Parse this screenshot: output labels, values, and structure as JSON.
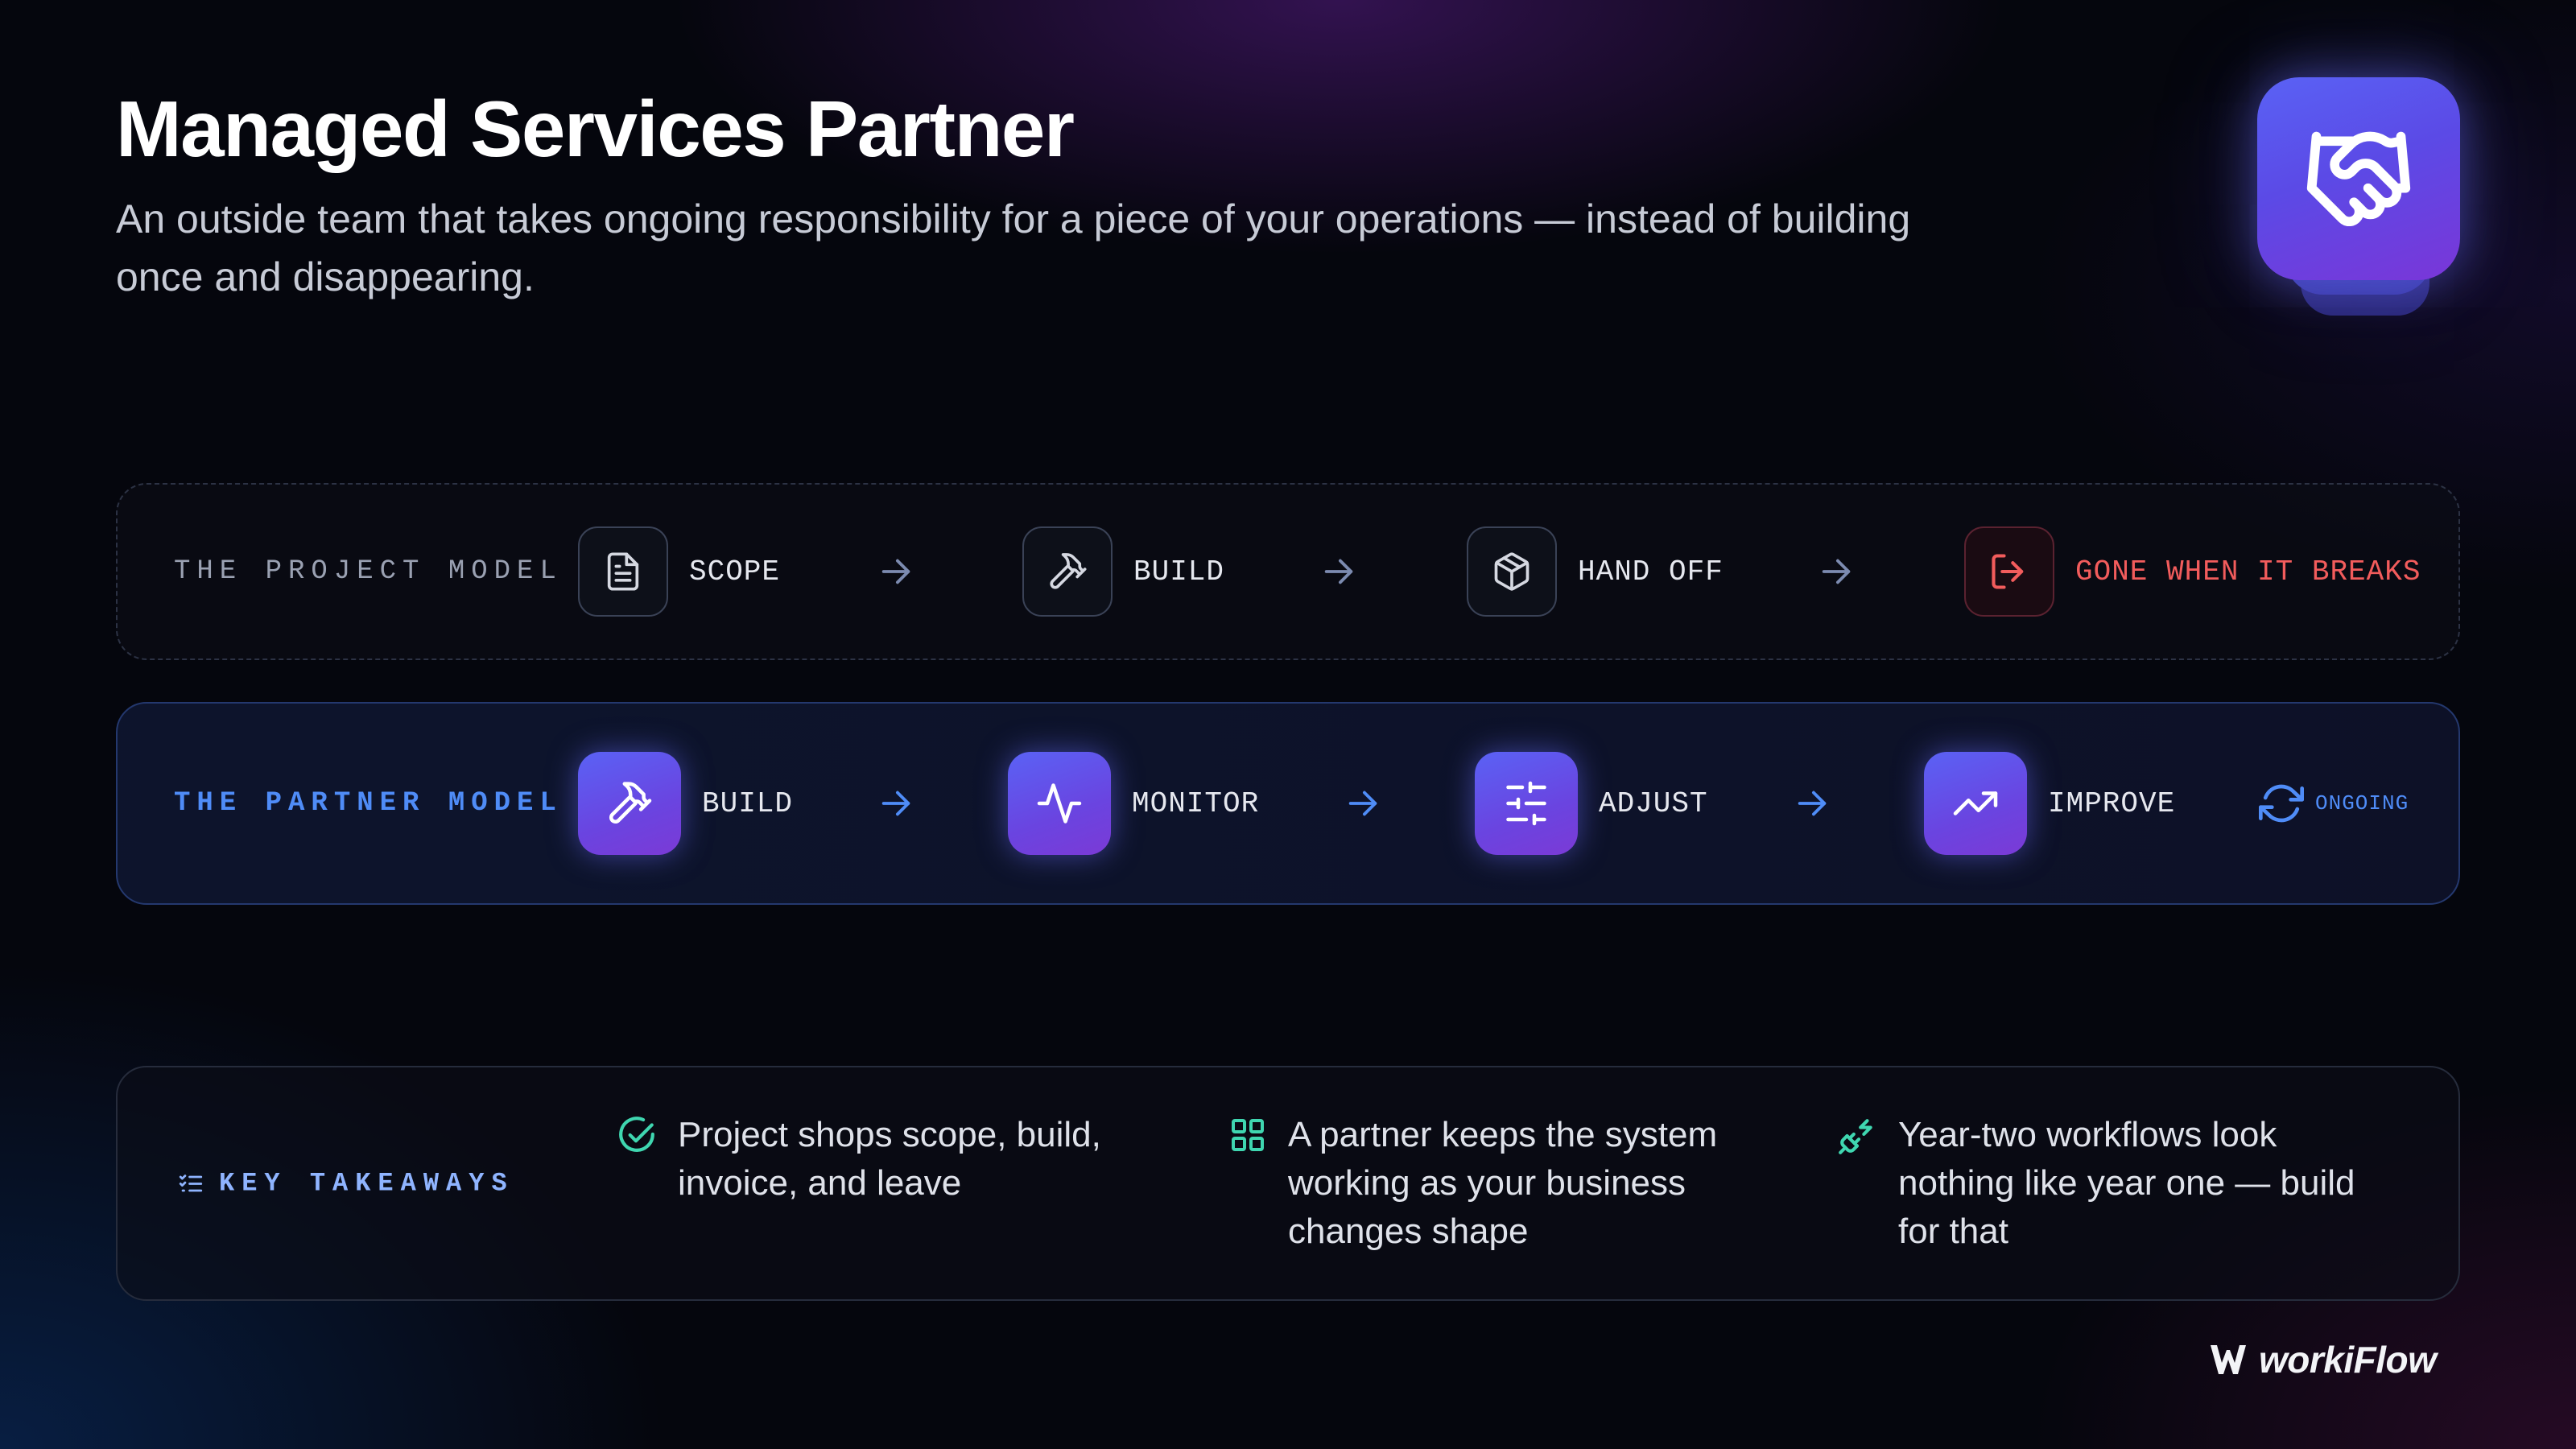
{
  "header": {
    "title": "Managed Services Partner",
    "subtitle": "An outside team that takes ongoing responsibility for a piece of your operations — instead of building once and disappearing.",
    "hero_icon": "handshake-icon"
  },
  "project_model": {
    "label": "THE PROJECT MODEL",
    "steps": [
      {
        "label": "SCOPE",
        "icon": "document-icon"
      },
      {
        "label": "BUILD",
        "icon": "hammer-icon"
      },
      {
        "label": "HAND OFF",
        "icon": "box-icon"
      },
      {
        "label": "GONE WHEN IT BREAKS",
        "icon": "exit-icon"
      }
    ]
  },
  "partner_model": {
    "label": "THE PARTNER MODEL",
    "steps": [
      {
        "label": "BUILD",
        "icon": "hammer-icon"
      },
      {
        "label": "MONITOR",
        "icon": "pulse-icon"
      },
      {
        "label": "ADJUST",
        "icon": "sliders-icon"
      },
      {
        "label": "IMPROVE",
        "icon": "trend-up-icon"
      }
    ],
    "ongoing_label": "ONGOING"
  },
  "takeaways": {
    "label": "KEY TAKEAWAYS",
    "items": [
      {
        "text": "Project shops scope, build, invoice, and leave",
        "icon": "check-circle-icon"
      },
      {
        "text": "A partner keeps the system working as your business changes shape",
        "icon": "grid-icon"
      },
      {
        "text": "Year-two workflows look nothing like year one — build for that",
        "icon": "plug-icon"
      }
    ]
  },
  "brand": {
    "name": "workiFlow",
    "logo": "workiflow-logo"
  },
  "colors": {
    "accent_blue": "#4f8cf7",
    "accent_purple": "#6a44e0",
    "danger": "#f25c5c",
    "takeaway_icon": "#3fd6b0"
  }
}
